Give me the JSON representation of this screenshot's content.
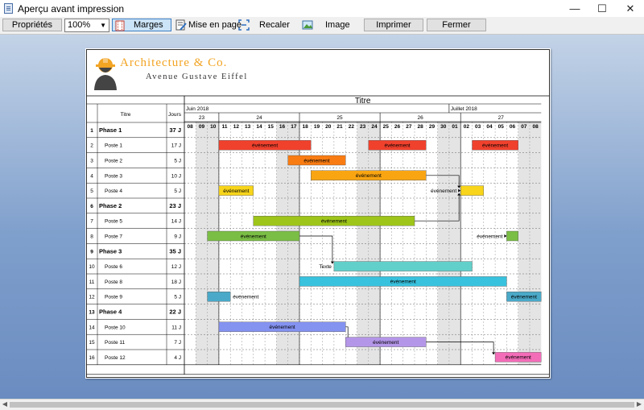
{
  "window": {
    "title": "Aperçu avant impression",
    "minimize": "—",
    "maximize": "☐",
    "close": "✕"
  },
  "toolbar": {
    "properties": "Propriétés",
    "zoom": "100%",
    "margins": "Marges",
    "page_setup": "Mise en page",
    "fit": "Recaler",
    "image": "Image",
    "print": "Imprimer",
    "close": "Fermer"
  },
  "header": {
    "company": "Architecture & Co.",
    "address": "Avenue Gustave Eiffel"
  },
  "gantt": {
    "title": "Titre",
    "col_title": "Titre",
    "col_days": "Jours",
    "months": [
      {
        "label": "Juin 2018",
        "start": 0
      },
      {
        "label": "Juillet 2018",
        "start": 23
      }
    ],
    "weeks": [
      {
        "label": "23",
        "start": 0,
        "len": 3
      },
      {
        "label": "24",
        "start": 3,
        "len": 7
      },
      {
        "label": "25",
        "start": 10,
        "len": 7
      },
      {
        "label": "26",
        "start": 17,
        "len": 7
      },
      {
        "label": "27",
        "start": 24,
        "len": 7
      }
    ],
    "days": [
      "08",
      "09",
      "10",
      "11",
      "12",
      "13",
      "14",
      "15",
      "16",
      "17",
      "18",
      "19",
      "20",
      "21",
      "22",
      "23",
      "24",
      "25",
      "26",
      "27",
      "28",
      "29",
      "30",
      "01",
      "02",
      "03",
      "04",
      "05",
      "06",
      "07",
      "08"
    ],
    "weekend_days": [
      1,
      2,
      8,
      9,
      15,
      16,
      22,
      23,
      29,
      30
    ],
    "rows": [
      {
        "num": "1",
        "name": "Phase 1",
        "days": "37 J",
        "phase": true
      },
      {
        "num": "2",
        "name": "Poste 1",
        "days": "17 J"
      },
      {
        "num": "3",
        "name": "Poste 2",
        "days": "5 J"
      },
      {
        "num": "4",
        "name": "Poste 3",
        "days": "10 J"
      },
      {
        "num": "5",
        "name": "Poste 4",
        "days": "5 J"
      },
      {
        "num": "6",
        "name": "Phase 2",
        "days": "23 J",
        "phase": true
      },
      {
        "num": "7",
        "name": "Poste 5",
        "days": "14 J"
      },
      {
        "num": "8",
        "name": "Poste 7",
        "days": "9 J"
      },
      {
        "num": "9",
        "name": "Phase 3",
        "days": "35 J",
        "phase": true
      },
      {
        "num": "10",
        "name": "Poste 6",
        "days": "12 J"
      },
      {
        "num": "11",
        "name": "Poste 8",
        "days": "18 J"
      },
      {
        "num": "12",
        "name": "Poste 9",
        "days": "5 J"
      },
      {
        "num": "13",
        "name": "Phase 4",
        "days": "22 J",
        "phase": true
      },
      {
        "num": "14",
        "name": "Poste 10",
        "days": "11 J"
      },
      {
        "num": "15",
        "name": "Poste 11",
        "days": "7 J"
      },
      {
        "num": "16",
        "name": "Poste 12",
        "days": "4 J"
      }
    ],
    "bars": [
      {
        "row": 1,
        "start": 3,
        "end": 11,
        "color": "#f0412d",
        "label": "événement",
        "label_pos": "inside"
      },
      {
        "row": 1,
        "start": 16,
        "end": 21,
        "color": "#f0412d",
        "label": "événement",
        "label_pos": "inside"
      },
      {
        "row": 1,
        "start": 25,
        "end": 29,
        "color": "#f0412d",
        "label": "événement",
        "label_pos": "inside"
      },
      {
        "row": 2,
        "start": 9,
        "end": 14,
        "color": "#f97c12",
        "label": "événement",
        "label_pos": "inside"
      },
      {
        "row": 3,
        "start": 11,
        "end": 21,
        "color": "#f9a512",
        "label": "événement",
        "label_pos": "inside"
      },
      {
        "row": 4,
        "start": 3,
        "end": 6,
        "color": "#f8d51a",
        "label": "événement",
        "label_pos": "inside"
      },
      {
        "row": 4,
        "start": 24,
        "end": 26,
        "color": "#f8d51a",
        "label": "événement",
        "label_pos": "left"
      },
      {
        "row": 6,
        "start": 6,
        "end": 20,
        "color": "#9ec51a",
        "label": "événement",
        "label_pos": "inside"
      },
      {
        "row": 7,
        "start": 2,
        "end": 10,
        "color": "#7bbe45",
        "label": "événement",
        "label_pos": "inside"
      },
      {
        "row": 7,
        "start": 28,
        "end": 29,
        "color": "#7bbe45",
        "label": "événement",
        "label_pos": "left"
      },
      {
        "row": 9,
        "start": 13,
        "end": 25,
        "color": "#62d0ca",
        "label": "Texte",
        "label_pos": "left"
      },
      {
        "row": 10,
        "start": 10,
        "end": 28,
        "color": "#38c2de",
        "label": "événement",
        "label_pos": "inside"
      },
      {
        "row": 11,
        "start": 2,
        "end": 4,
        "color": "#4aa9c8",
        "label": "événement",
        "label_pos": "right"
      },
      {
        "row": 11,
        "start": 28,
        "end": 31,
        "color": "#4aa9c8",
        "label": "événement",
        "label_pos": "inside"
      },
      {
        "row": 13,
        "start": 3,
        "end": 14,
        "color": "#8492f0",
        "label": "événement",
        "label_pos": "inside"
      },
      {
        "row": 14,
        "start": 14,
        "end": 21,
        "color": "#b496e8",
        "label": "événement",
        "label_pos": "inside"
      },
      {
        "row": 15,
        "start": 27,
        "end": 31,
        "color": "#f36cb8",
        "label": "événement",
        "label_pos": "inside"
      }
    ],
    "links": [
      {
        "from_row": 3,
        "from_day": 21,
        "to_row": 4,
        "to_day": 24
      },
      {
        "from_row": 6,
        "from_day": 20,
        "to_row": 4,
        "to_day": 24
      },
      {
        "from_row": 7,
        "from_day": 10,
        "to_row": 9,
        "to_day": 13
      },
      {
        "from_row": 13,
        "from_day": 14,
        "to_row": 14,
        "to_day": 14
      },
      {
        "from_row": 14,
        "from_day": 21,
        "to_row": 15,
        "to_day": 27
      }
    ]
  },
  "colors": {
    "workspace_top": "#c3d3e7",
    "workspace_bottom": "#6a8cc0",
    "logo": "#f2a423"
  }
}
